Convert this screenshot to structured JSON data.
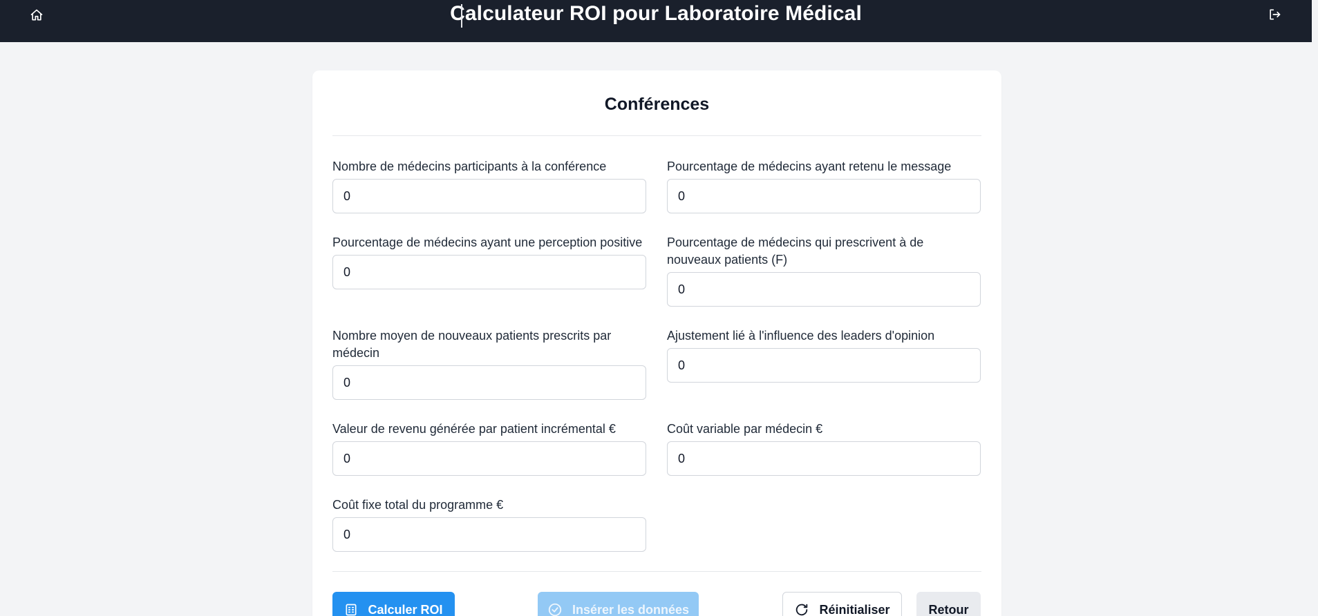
{
  "header": {
    "title": "Calculateur ROI pour Laboratoire Médical",
    "home_icon": "home-icon",
    "logout_icon": "logout-icon"
  },
  "form": {
    "heading": "Conférences",
    "fields": [
      {
        "label": "Nombre de médecins participants à la conférence",
        "value": "0"
      },
      {
        "label": "Pourcentage de médecins ayant retenu le message",
        "value": "0"
      },
      {
        "label": "Pourcentage de médecins ayant une perception positive",
        "value": "0"
      },
      {
        "label": "Pourcentage de médecins qui prescrivent à de nouveaux patients (F)",
        "value": "0"
      },
      {
        "label": "Nombre moyen de nouveaux patients prescrits par médecin",
        "value": "0"
      },
      {
        "label": "Ajustement lié à l'influence des leaders d'opinion",
        "value": "0"
      },
      {
        "label": "Valeur de revenu générée par patient incrémental €",
        "value": "0"
      },
      {
        "label": "Coût variable par médecin €",
        "value": "0"
      },
      {
        "label": "Coût fixe total du programme €",
        "value": "0"
      }
    ]
  },
  "actions": {
    "calculate": "Calculer ROI",
    "insert": "Insérer les données",
    "reset": "Réinitialiser",
    "back": "Retour"
  },
  "colors": {
    "topbar": "#1a202c",
    "primary": "#2491f0",
    "primary_disabled": "#93c9f5",
    "background": "#f3f4f6"
  }
}
